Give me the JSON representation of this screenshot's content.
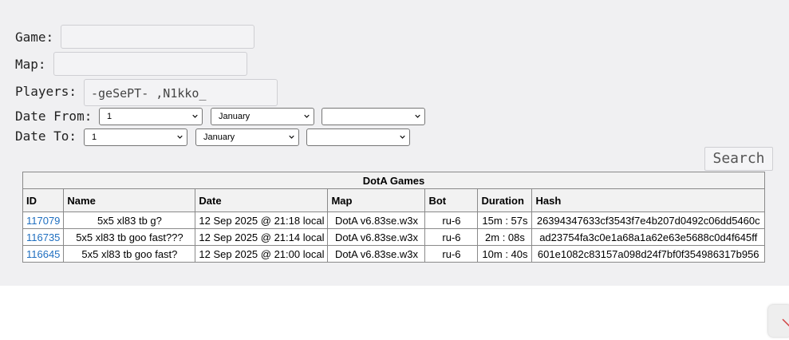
{
  "form": {
    "game_label": "Game:",
    "game_value": "",
    "map_label": "Map:",
    "map_value": "",
    "players_label": "Players:",
    "players_value": "-geSePT- ,N1kko_",
    "date_from_label": "Date From:",
    "date_to_label": "Date To:",
    "date_from": {
      "day": "1",
      "month": "January",
      "year": ""
    },
    "date_to": {
      "day": "1",
      "month": "January",
      "year": ""
    },
    "search_label": "Search"
  },
  "table": {
    "caption": "DotA Games",
    "headers": [
      "ID",
      "Name",
      "Date",
      "Map",
      "Bot",
      "Duration",
      "Hash"
    ],
    "rows": [
      {
        "id": "117079",
        "name": "5x5 xl83 tb g?",
        "date": "12 Sep 2025 @ 21:18 local",
        "map": "DotA v6.83se.w3x",
        "bot": "ru-6",
        "duration": "15m : 57s",
        "hash": "26394347633cf3543f7e4b207d0492c06dd5460c"
      },
      {
        "id": "116735",
        "name": "5x5 xl83 tb goo fast???",
        "date": "12 Sep 2025 @ 21:14 local",
        "map": "DotA v6.83se.w3x",
        "bot": "ru-6",
        "duration": "2m : 08s",
        "hash": "ad23754fa3c0e1a68a1a62e63e5688c0d4f645ff"
      },
      {
        "id": "116645",
        "name": "5x5 xl83 tb goo fast?",
        "date": "12 Sep 2025 @ 21:00 local",
        "map": "DotA v6.83se.w3x",
        "bot": "ru-6",
        "duration": "10m : 40s",
        "hash": "601e1082c83157a098d24f7bf0f354986317b956"
      }
    ]
  },
  "colors": {
    "link": "#1f6fc0",
    "panel_bg": "#f0f0f2"
  },
  "icons": {
    "select_arrow": "chevron-down-icon"
  }
}
